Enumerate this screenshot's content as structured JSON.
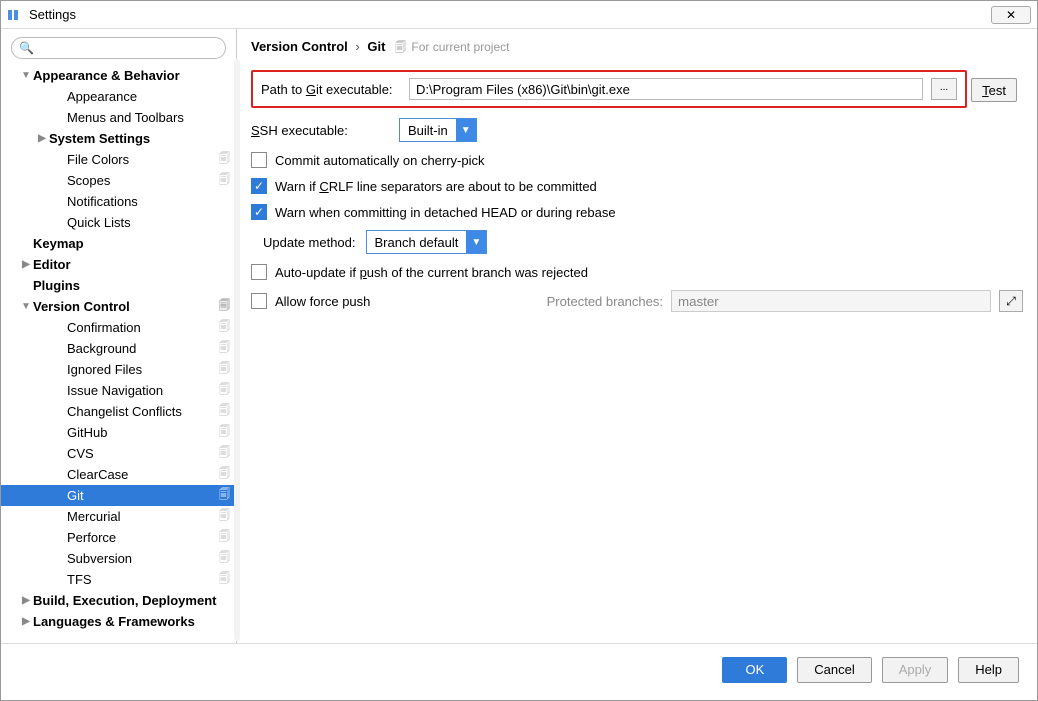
{
  "window": {
    "title": "Settings",
    "close": "✕"
  },
  "search": {
    "placeholder": ""
  },
  "tree": [
    {
      "label": "Appearance & Behavior",
      "depth": "depth1",
      "arrow": "down",
      "copy": false
    },
    {
      "label": "Appearance",
      "depth": "depth2",
      "arrow": "none",
      "copy": false
    },
    {
      "label": "Menus and Toolbars",
      "depth": "depth2",
      "arrow": "none",
      "copy": false
    },
    {
      "label": "System Settings",
      "depth": "depth2b",
      "arrow": "right",
      "copy": false
    },
    {
      "label": "File Colors",
      "depth": "depth2",
      "arrow": "none",
      "copy": true
    },
    {
      "label": "Scopes",
      "depth": "depth2",
      "arrow": "none",
      "copy": true
    },
    {
      "label": "Notifications",
      "depth": "depth2",
      "arrow": "none",
      "copy": false
    },
    {
      "label": "Quick Lists",
      "depth": "depth2",
      "arrow": "none",
      "copy": false
    },
    {
      "label": "Keymap",
      "depth": "depth1",
      "arrow": "none",
      "copy": false
    },
    {
      "label": "Editor",
      "depth": "depth1",
      "arrow": "right",
      "copy": false
    },
    {
      "label": "Plugins",
      "depth": "depth1",
      "arrow": "none",
      "copy": false
    },
    {
      "label": "Version Control",
      "depth": "depth1",
      "arrow": "down",
      "copy": true
    },
    {
      "label": "Confirmation",
      "depth": "depth2",
      "arrow": "none",
      "copy": true
    },
    {
      "label": "Background",
      "depth": "depth2",
      "arrow": "none",
      "copy": true
    },
    {
      "label": "Ignored Files",
      "depth": "depth2",
      "arrow": "none",
      "copy": true
    },
    {
      "label": "Issue Navigation",
      "depth": "depth2",
      "arrow": "none",
      "copy": true
    },
    {
      "label": "Changelist Conflicts",
      "depth": "depth2",
      "arrow": "none",
      "copy": true
    },
    {
      "label": "GitHub",
      "depth": "depth2",
      "arrow": "none",
      "copy": true
    },
    {
      "label": "CVS",
      "depth": "depth2",
      "arrow": "none",
      "copy": true
    },
    {
      "label": "ClearCase",
      "depth": "depth2",
      "arrow": "none",
      "copy": true
    },
    {
      "label": "Git",
      "depth": "depth2",
      "arrow": "none",
      "copy": true,
      "selected": true
    },
    {
      "label": "Mercurial",
      "depth": "depth2",
      "arrow": "none",
      "copy": true
    },
    {
      "label": "Perforce",
      "depth": "depth2",
      "arrow": "none",
      "copy": true
    },
    {
      "label": "Subversion",
      "depth": "depth2",
      "arrow": "none",
      "copy": true
    },
    {
      "label": "TFS",
      "depth": "depth2",
      "arrow": "none",
      "copy": true
    },
    {
      "label": "Build, Execution, Deployment",
      "depth": "depth1",
      "arrow": "right",
      "copy": false
    },
    {
      "label": "Languages & Frameworks",
      "depth": "depth1",
      "arrow": "right",
      "copy": false
    }
  ],
  "breadcrumb": {
    "p1": "Version Control",
    "p2": "Git",
    "scope": "For current project"
  },
  "git": {
    "path_label": "Path to Git executable:",
    "path_value": "D:\\Program Files (x86)\\Git\\bin\\git.exe",
    "browse": "...",
    "test": "Test",
    "ssh_label": "SSH executable:",
    "ssh_value": "Built-in",
    "cb_cherry": "Commit automatically on cherry-pick",
    "cb_crlf": "Warn if CRLF line separators are about to be committed",
    "cb_detached": "Warn when committing in detached HEAD or during rebase",
    "update_label": "Update method:",
    "update_value": "Branch default",
    "cb_autoupdate": "Auto-update if push of the current branch was rejected",
    "cb_force": "Allow force push",
    "protected_label": "Protected branches:",
    "protected_value": "master"
  },
  "footer": {
    "ok": "OK",
    "cancel": "Cancel",
    "apply": "Apply",
    "help": "Help"
  }
}
